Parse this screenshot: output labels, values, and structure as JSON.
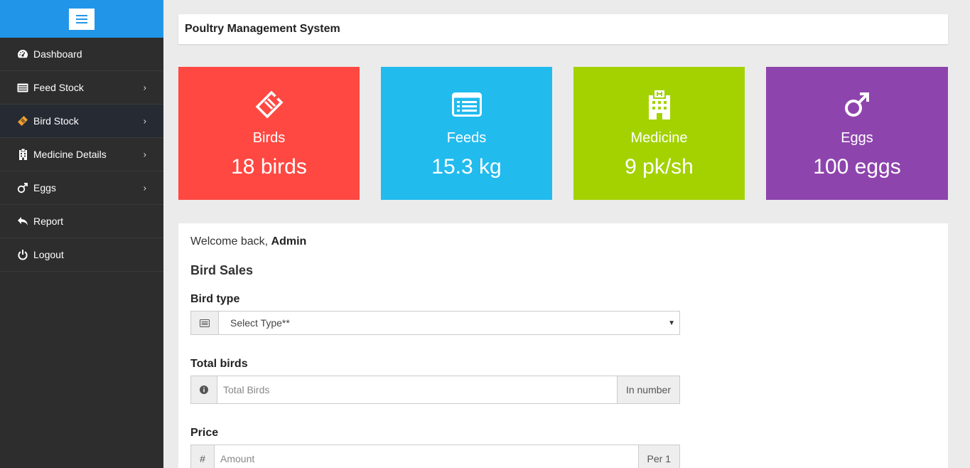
{
  "sidebar": {
    "items": [
      {
        "label": "Dashboard",
        "icon": "dashboard-icon"
      },
      {
        "label": "Feed Stock",
        "icon": "list-icon"
      },
      {
        "label": "Bird Stock",
        "icon": "ticket-icon"
      },
      {
        "label": "Medicine Details",
        "icon": "hospital-icon"
      },
      {
        "label": "Eggs",
        "icon": "mars-icon"
      },
      {
        "label": "Report",
        "icon": "reply-icon"
      },
      {
        "label": "Logout",
        "icon": "power-icon"
      }
    ]
  },
  "header": {
    "title": "Poultry Management System"
  },
  "tiles": [
    {
      "label": "Birds",
      "value": "18 birds",
      "color": "#ff4842",
      "icon": "ticket-icon"
    },
    {
      "label": "Feeds",
      "value": "15.3 kg",
      "color": "#22bbee",
      "icon": "list-icon"
    },
    {
      "label": "Medicine",
      "value": "9 pk/sh",
      "color": "#a3d200",
      "icon": "hospital-icon"
    },
    {
      "label": "Eggs",
      "value": "100 eggs",
      "color": "#8e44ad",
      "icon": "mars-icon"
    }
  ],
  "panel": {
    "welcome_prefix": "Welcome back, ",
    "welcome_user": "Admin",
    "section_title": "Bird Sales",
    "bird_type": {
      "label": "Bird type",
      "value": "Select Type**"
    },
    "total_birds": {
      "label": "Total birds",
      "placeholder": "Total Birds",
      "suffix": "In number"
    },
    "price": {
      "label": "Price",
      "prefix": "#",
      "placeholder": "Amount",
      "suffix": "Per 1"
    }
  }
}
